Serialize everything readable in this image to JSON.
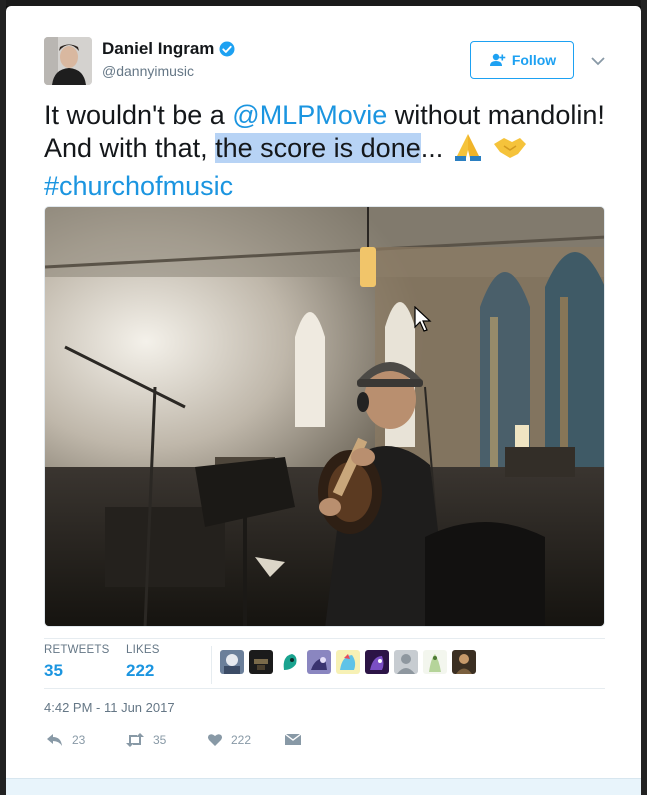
{
  "author": {
    "name": "Daniel Ingram",
    "handle": "@dannyimusic",
    "verified": true
  },
  "follow_button": {
    "label": "Follow",
    "icon": "add-user-icon"
  },
  "tweet": {
    "text_1": "It wouldn't be a ",
    "mention": "@MLPMovie",
    "text_2": " without mandolin! And with that, ",
    "highlighted": "the score is done",
    "text_3": "... ",
    "emojis": [
      "folded-hands-icon",
      "handshake-icon"
    ],
    "hashtag": "#churchofmusic"
  },
  "stats": {
    "retweets_label": "RETWEETS",
    "retweets_count": "35",
    "likes_label": "LIKES",
    "likes_count": "222"
  },
  "timestamp": "4:42 PM - 11 Jun 2017",
  "actions": {
    "reply_count": "23",
    "retweet_count": "35",
    "like_count": "222"
  },
  "colors": {
    "link": "#1b95e0",
    "follow_accent": "#1da1f2",
    "highlight": "#b7d3f5",
    "verified": "#1da1f2"
  }
}
